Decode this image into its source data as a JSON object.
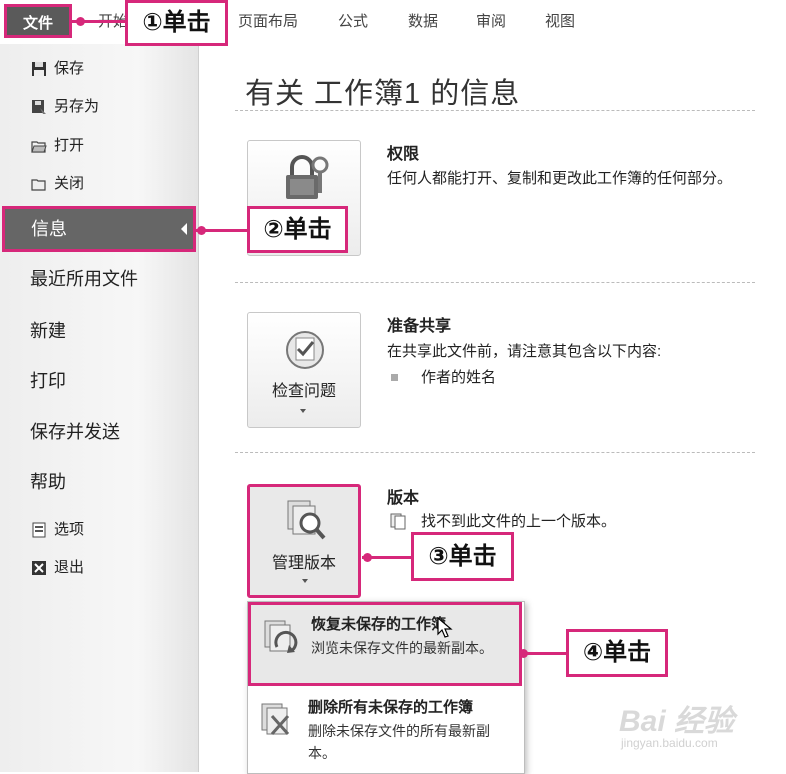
{
  "ribbon": {
    "file_tab": "文件",
    "tabs": [
      "开始",
      "页面布局",
      "公式",
      "数据",
      "审阅",
      "视图"
    ]
  },
  "sidebar": {
    "small_items": [
      "保存",
      "另存为",
      "打开",
      "关闭"
    ],
    "info": "信息",
    "big_items": [
      "最近所用文件",
      "新建",
      "打印",
      "保存并发送",
      "帮助"
    ],
    "bottom_items": [
      "选项",
      "退出"
    ]
  },
  "main": {
    "title": "有关 工作簿1 的信息",
    "permissions": {
      "title": "权限",
      "text": "任何人都能打开、复制和更改此工作簿的任何部分。"
    },
    "prepare": {
      "button_label": "检查问题",
      "title": "准备共享",
      "text": "在共享此文件前，请注意其包含以下内容:",
      "bullet": "作者的姓名"
    },
    "versions": {
      "button_label": "管理版本",
      "title": "版本",
      "text": "找不到此文件的上一个版本。"
    },
    "menu": {
      "recover_title": "恢复未保存的工作簿",
      "recover_desc": "浏览未保存文件的最新副本。",
      "delete_title": "删除所有未保存的工作簿",
      "delete_desc": "删除未保存文件的所有最新副本。"
    }
  },
  "callouts": {
    "c1": "①单击",
    "c2": "②单击",
    "c3": "③单击",
    "c4": "④单击"
  },
  "watermark": {
    "brand": "Bai 经验",
    "url": "jingyan.baidu.com"
  },
  "colors": {
    "accent": "#d6287a",
    "selected_bg": "#666666"
  }
}
